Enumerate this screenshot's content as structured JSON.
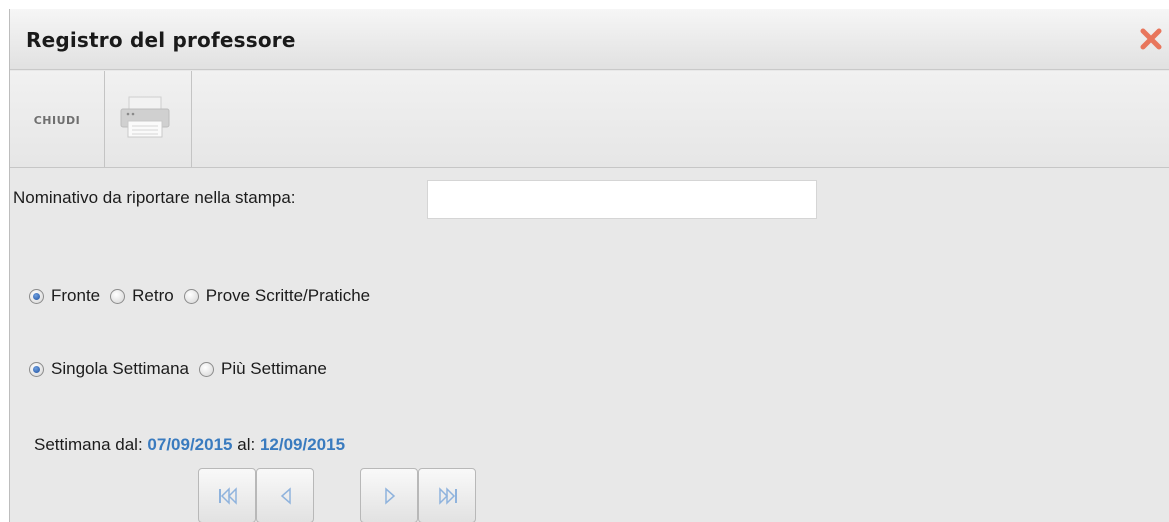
{
  "window": {
    "title": "Registro del professore",
    "close_icon": "close-x-icon",
    "accent_close": "#e8765c"
  },
  "toolbar": {
    "close_label": "CHIUDI",
    "print_icon": "printer-icon"
  },
  "form": {
    "name_label": "Nominativo da riportare nella stampa:",
    "name_value": "",
    "side_options": [
      {
        "label": "Fronte",
        "selected": true
      },
      {
        "label": "Retro",
        "selected": false
      },
      {
        "label": "Prove Scritte/Pratiche",
        "selected": false
      }
    ],
    "range_options": [
      {
        "label": "Singola Settimana",
        "selected": true
      },
      {
        "label": "Più Settimane",
        "selected": false
      }
    ],
    "week_from_label": "Settimana dal:",
    "week_from": "07/09/2015",
    "week_to_label": "al:",
    "week_to": "12/09/2015"
  },
  "navigation": {
    "icons": [
      "first-week-icon",
      "previous-week-icon",
      "next-week-icon",
      "last-week-icon"
    ],
    "icon_color": "#8fb3dd"
  }
}
